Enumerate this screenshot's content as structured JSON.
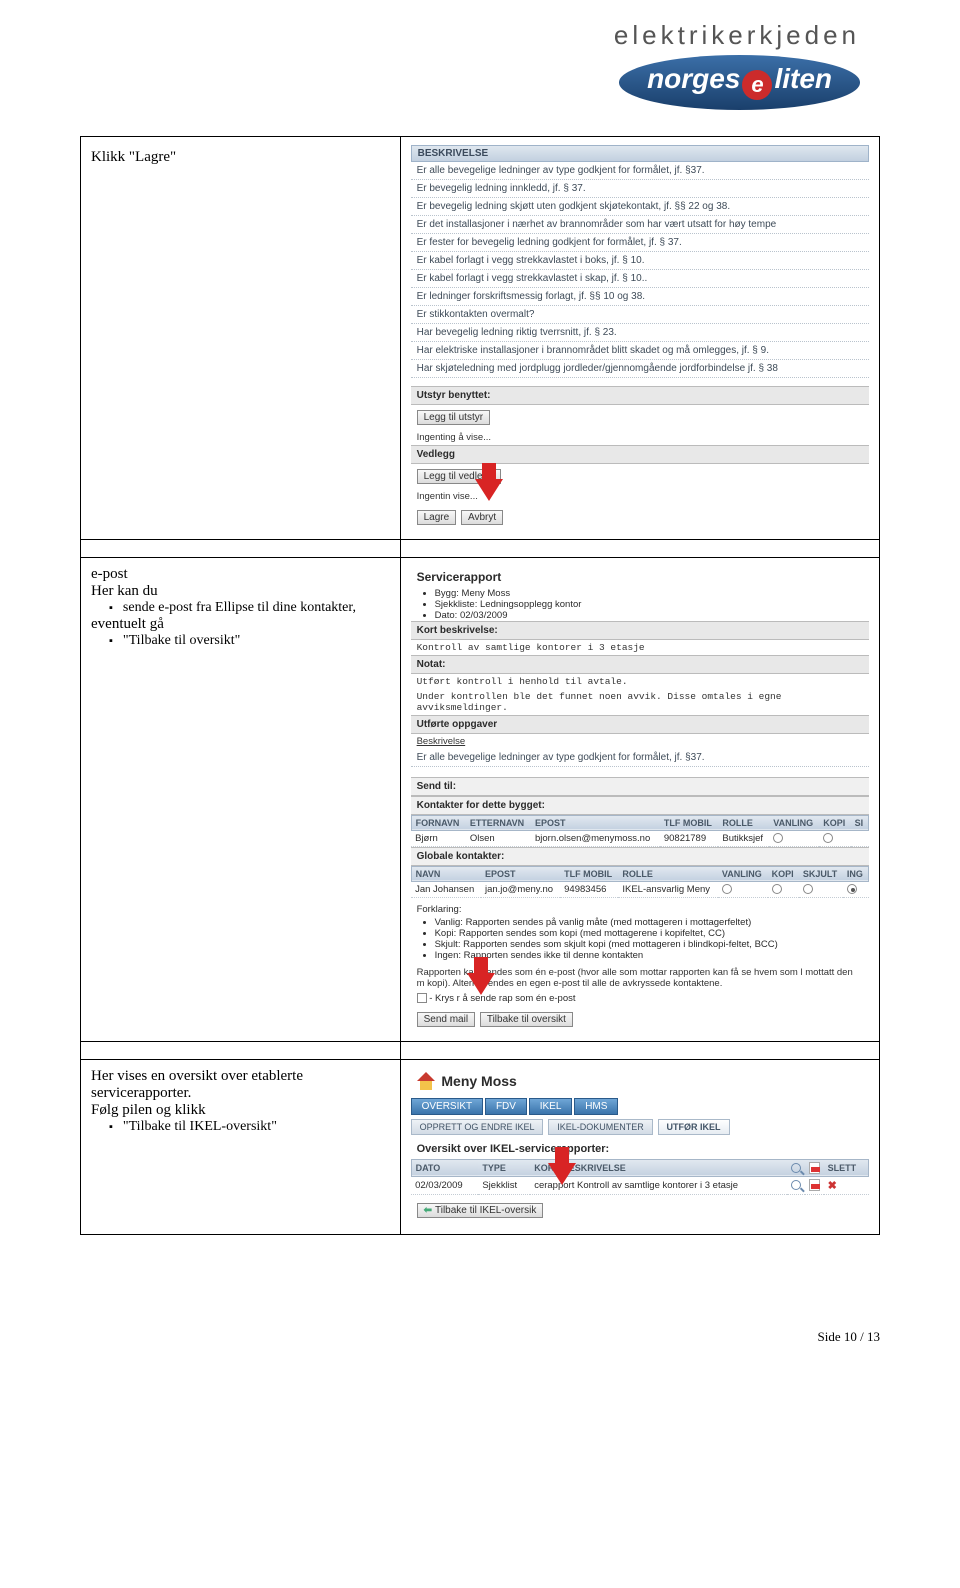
{
  "header": {
    "brand_line1": "elektrikerkjeden",
    "brand_norges": "norges",
    "brand_e": "e",
    "brand_liten": "liten"
  },
  "row1": {
    "left_title": "Klikk \"Lagre\"",
    "beskrivelse_header": "BESKRIVELSE",
    "items": [
      "Er alle bevegelige ledninger av type godkjent for formålet, jf. §37.",
      "Er bevegelig ledning innkledd, jf. § 37.",
      "Er bevegelig ledning skjøtt uten godkjent skjøtekontakt, jf. §§ 22 og 38.",
      "Er det installasjoner i nærhet av brannområder som har vært utsatt for høy tempe",
      "Er fester for bevegelig ledning godkjent for formålet, jf. § 37.",
      "Er kabel forlagt i vegg strekkavlastet i boks, jf. § 10.",
      "Er kabel forlagt i vegg strekkavlastet i skap, jf. § 10..",
      "Er ledninger forskriftsmessig forlagt, jf. §§ 10 og 38.",
      "Er stikkontakten overmalt?",
      "Har bevegelig ledning riktig tverrsnitt, jf. § 23.",
      "Har elektriske installasjoner i brannområdet blitt skadet og må omlegges, jf. § 9.",
      "Har skjøteledning med jordplugg jordleder/gjennomgående jordforbindelse jf. § 38"
    ],
    "utstyr_header": "Utstyr benyttet:",
    "btn_leggtilutstyr": "Legg til utstyr",
    "ingenting": "Ingenting å vise...",
    "vedlegg_header": "Vedlegg",
    "btn_leggtilvedlegg": "Legg til vedlegg",
    "ingenting2": "Ingentin    vise...",
    "btn_lagre": "Lagre",
    "btn_avbryt": "Avbryt"
  },
  "row2": {
    "left_intro": "e-post",
    "left_line2": "Her kan du",
    "bullet1": "sende e-post fra Ellipse til dine kontakter,",
    "left_line3": "eventuelt gå",
    "bullet2": "\"Tilbake til oversikt\"",
    "title": "Servicerapport",
    "meta": [
      "Bygg: Meny Moss",
      "Sjekkliste: Ledningsopplegg kontor",
      "Dato: 02/03/2009"
    ],
    "kort_header": "Kort beskrivelse:",
    "kort_text": "Kontroll av samtlige kontorer i 3 etasje",
    "notat_header": "Notat:",
    "notat1": "Utført kontroll i henhold til avtale.",
    "notat2": "Under kontrollen ble det funnet noen avvik. Disse omtales i egne avviksmeldinger.",
    "utforte_header": "Utførte oppgaver",
    "beskrivelse_sub": "Beskrivelse",
    "besk_line": "Er alle bevegelige ledninger av type godkjent for formålet, jf. §37.",
    "send_til": "Send til:",
    "kontakter_bygg": "Kontakter for dette bygget:",
    "th_fornavn": "FORNAVN",
    "th_etternavn": "ETTERNAVN",
    "th_epost": "EPOST",
    "th_tlf": "TLF MOBIL",
    "th_rolle": "ROLLE",
    "th_vanling": "VANLING",
    "th_kopi": "KOPI",
    "th_si": "SI",
    "c1_fn": "Bjørn",
    "c1_en": "Olsen",
    "c1_ep": "bjorn.olsen@menymoss.no",
    "c1_tlf": "90821789",
    "c1_rolle": "Butikksjef",
    "globale": "Globale kontakter:",
    "th_navn": "NAVN",
    "th_skjult": "SKJULT",
    "th_ing": "ING",
    "g1_navn": "Jan Johansen",
    "g1_ep": "jan.jo@meny.no",
    "g1_tlf": "94983456",
    "g1_rolle": "IKEL-ansvarlig Meny",
    "forklaring": "Forklaring:",
    "fv": "Vanlig: Rapporten sendes på vanlig måte (med mottageren i mottagerfeltet)",
    "fk": "Kopi: Rapporten sendes som kopi (med mottagerene i kopifeltet, CC)",
    "fs": "Skjult: Rapporten sendes som skjult kopi (med mottageren i blindkopi-feltet, BCC)",
    "fi": "Ingen: Rapporten sendes ikke til denne kontakten",
    "rap_note": "Rapporten kan sendes som én e-post (hvor alle som mottar rapporten kan få se hvem som l mottatt den     m kopi). Alternat       endes en egen e-post til alle de avkryssede kontaktene.",
    "kryss": "- Krys       r å sende rap        som én e-post",
    "btn_sendmail": "Send mail",
    "btn_tilbake": "Tilbake til oversikt"
  },
  "row3": {
    "left1": "Her vises en oversikt over etablerte servicerapporter.",
    "left2": "Følg pilen og klikk",
    "bullet": "\"Tilbake til IKEL-oversikt\"",
    "title": "Meny Moss",
    "tabs": [
      "OVERSIKT",
      "FDV",
      "IKEL",
      "HMS"
    ],
    "subtabs": [
      "OPPRETT OG ENDRE IKEL",
      "IKEL-DOKUMENTER",
      "UTFØR IKEL"
    ],
    "heading": "Oversikt over IKEL-servicerapporter:",
    "th_dato": "DATO",
    "th_type": "TYPE",
    "th_kortb": "KORT BESKRIVELSE",
    "th_slett": "SLETT",
    "d_dato": "02/03/2009",
    "d_type": "Sjekklist",
    "d_kort": "cerapport Kontroll av samtlige kontorer i 3 etasje",
    "btn_back": "Tilbake til IKEL-oversik"
  },
  "footer": {
    "page": "Side 10 / 13"
  }
}
